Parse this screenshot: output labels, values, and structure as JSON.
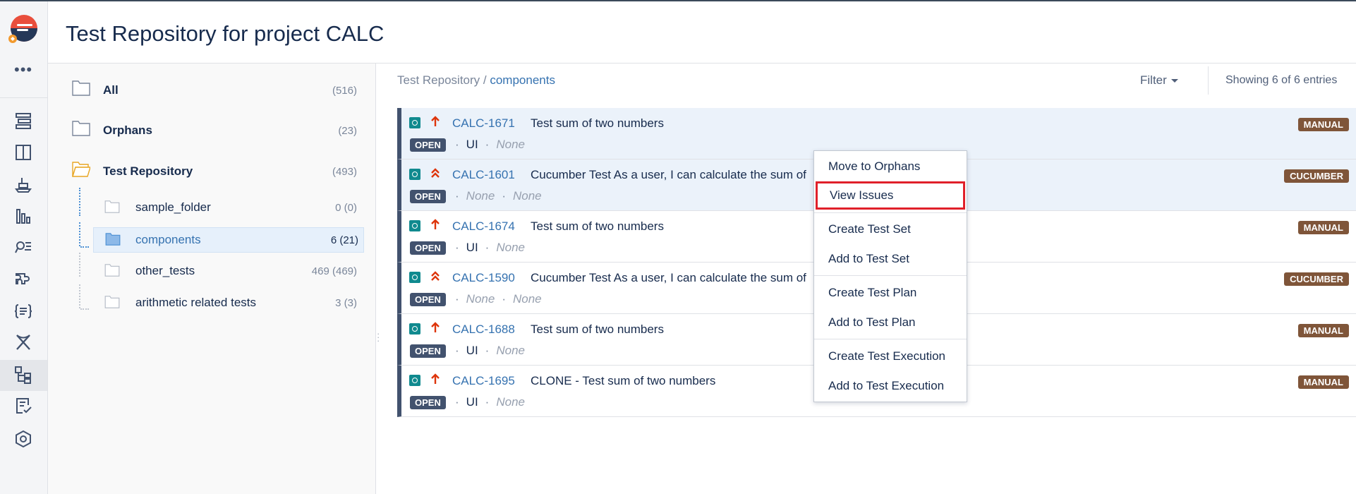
{
  "page_title": "Test Repository for project CALC",
  "rail": {
    "more": "•••",
    "icons": [
      "backlog-icon",
      "board-icon",
      "releases-icon",
      "reports-icon",
      "issues-search-icon",
      "components-icon",
      "test-sets-icon",
      "test-runs-icon",
      "test-repository-icon",
      "test-plans-icon",
      "settings-icon"
    ]
  },
  "tree": {
    "items": [
      {
        "label": "All",
        "count": "(516)"
      },
      {
        "label": "Orphans",
        "count": "(23)"
      },
      {
        "label": "Test Repository",
        "count": "(493)"
      },
      {
        "label": "sample_folder",
        "count": "0 (0)"
      },
      {
        "label": "components",
        "count": "6 (21)"
      },
      {
        "label": "other_tests",
        "count": "469 (469)"
      },
      {
        "label": "arithmetic related tests",
        "count": "3 (3)"
      }
    ]
  },
  "breadcrumb": {
    "root": "Test Repository",
    "sep": " / ",
    "current": "components"
  },
  "filter_label": "Filter",
  "showing": "Showing 6 of 6 entries",
  "tests": [
    {
      "key": "CALC-1671",
      "summary": "Test sum of two numbers",
      "status": "OPEN",
      "component": "UI",
      "label": "None",
      "type": "MANUAL"
    },
    {
      "key": "CALC-1601",
      "summary": "Cucumber Test As a user, I can calculate the sum of",
      "status": "OPEN",
      "component": "None",
      "label": "None",
      "type": "CUCUMBER"
    },
    {
      "key": "CALC-1674",
      "summary": "Test sum of two numbers",
      "status": "OPEN",
      "component": "UI",
      "label": "None",
      "type": "MANUAL"
    },
    {
      "key": "CALC-1590",
      "summary": "Cucumber Test As a user, I can calculate the sum of",
      "status": "OPEN",
      "component": "None",
      "label": "None",
      "type": "CUCUMBER"
    },
    {
      "key": "CALC-1688",
      "summary": "Test sum of two numbers",
      "status": "OPEN",
      "component": "UI",
      "label": "None",
      "type": "MANUAL"
    },
    {
      "key": "CALC-1695",
      "summary": "CLONE - Test sum of two numbers",
      "status": "OPEN",
      "component": "UI",
      "label": "None",
      "type": "MANUAL"
    }
  ],
  "menu": {
    "items": [
      "Move to Orphans",
      "View Issues",
      "Create Test Set",
      "Add to Test Set",
      "Create Test Plan",
      "Add to Test Plan",
      "Create Test Execution",
      "Add to Test Execution"
    ]
  },
  "colors": {
    "accent": "#3572b0",
    "status": "#42526e",
    "type_badge": "#7f5539",
    "highlight": "#e0202a"
  }
}
